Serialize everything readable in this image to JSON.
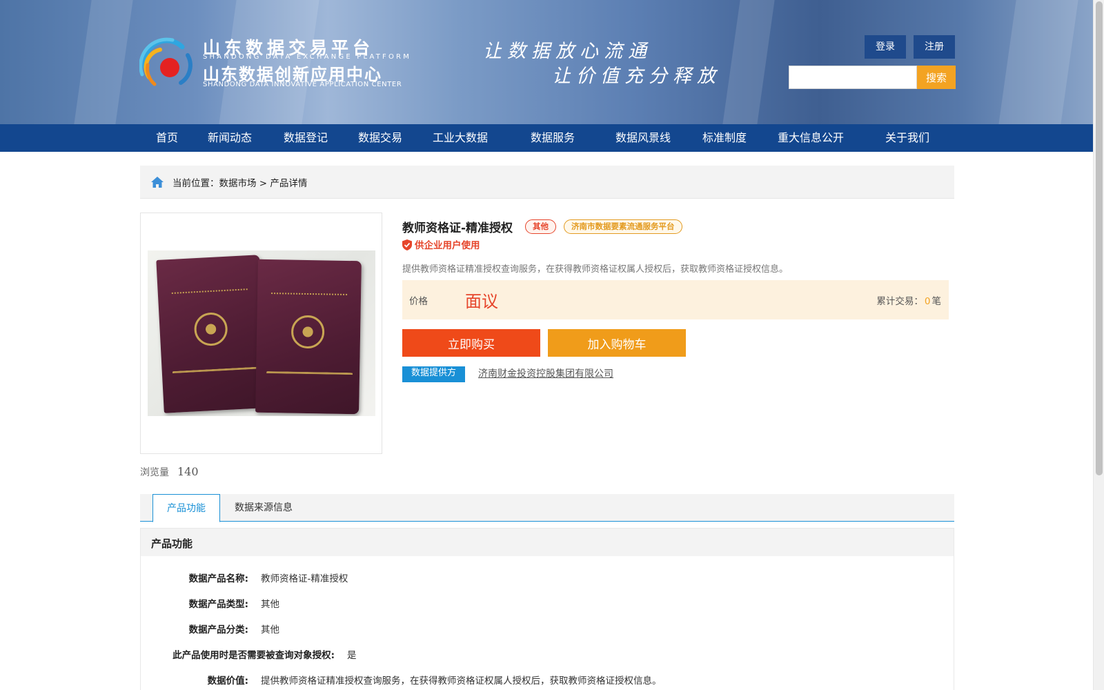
{
  "header": {
    "logo_cn_1": "山东数据交易平台",
    "logo_en_1": "SHANDONG DATA EXCHANGE PLATFORM",
    "logo_cn_2": "山东数据创新应用中心",
    "logo_en_2": "SHANDONG DATA INNOVATIVE APPLICATION CENTER",
    "slogan_1": "让数据放心流通",
    "slogan_2": "让价值充分释放",
    "login_label": "登录",
    "register_label": "注册",
    "search_value": "",
    "search_label": "搜索"
  },
  "nav": {
    "items": [
      {
        "label": "首页"
      },
      {
        "label": "新闻动态"
      },
      {
        "label": "数据登记"
      },
      {
        "label": "数据交易"
      },
      {
        "label": "工业大数据"
      },
      {
        "label": "数据服务"
      },
      {
        "label": "数据风景线"
      },
      {
        "label": "标准制度"
      },
      {
        "label": "重大信息公开"
      },
      {
        "label": "关于我们"
      }
    ]
  },
  "breadcrumb": {
    "prefix": "当前位置：",
    "level1": "数据市场",
    "separator": " > ",
    "level2": "产品详情"
  },
  "product": {
    "title": "教师资格证-精准授权",
    "tag_category": "其他",
    "tag_platform": "济南市数据要素流通服务平台",
    "enterprise_note": "供企业用户使用",
    "description": "提供教师资格证精准授权查询服务，在获得教师资格证权属人授权后，获取教师资格证授权信息。",
    "price_label": "价格",
    "price_value": "面议",
    "trade_label": "累计交易：",
    "trade_count": "0",
    "trade_unit": "笔",
    "buy_now_label": "立即购买",
    "add_cart_label": "加入购物车",
    "provider_badge": "数据提供方",
    "provider_name": "济南财金投资控股集团有限公司",
    "views_label": "浏览量",
    "views_count": "140"
  },
  "tabs": [
    {
      "label": "产品功能",
      "active": true
    },
    {
      "label": "数据来源信息",
      "active": false
    }
  ],
  "details": {
    "section_title": "产品功能",
    "rows": [
      {
        "label": "数据产品名称:",
        "value": "教师资格证-精准授权"
      },
      {
        "label": "数据产品类型:",
        "value": "其他"
      },
      {
        "label": "数据产品分类:",
        "value": "其他"
      },
      {
        "label": "此产品使用时是否需要被查询对象授权:",
        "value": "是"
      },
      {
        "label": "数据价值:",
        "value": "提供教师资格证精准授权查询服务，在获得教师资格证权属人授权后，获取教师资格证授权信息。"
      }
    ]
  },
  "colors": {
    "nav_bg": "#13478f",
    "accent_red": "#ef4a19",
    "accent_orange": "#f09c1a",
    "accent_blue": "#1990d6",
    "price_bg": "#fdf1de"
  },
  "icons": {
    "home": "home-icon",
    "shield": "shield-icon",
    "logo": "logo-mark-icon"
  }
}
